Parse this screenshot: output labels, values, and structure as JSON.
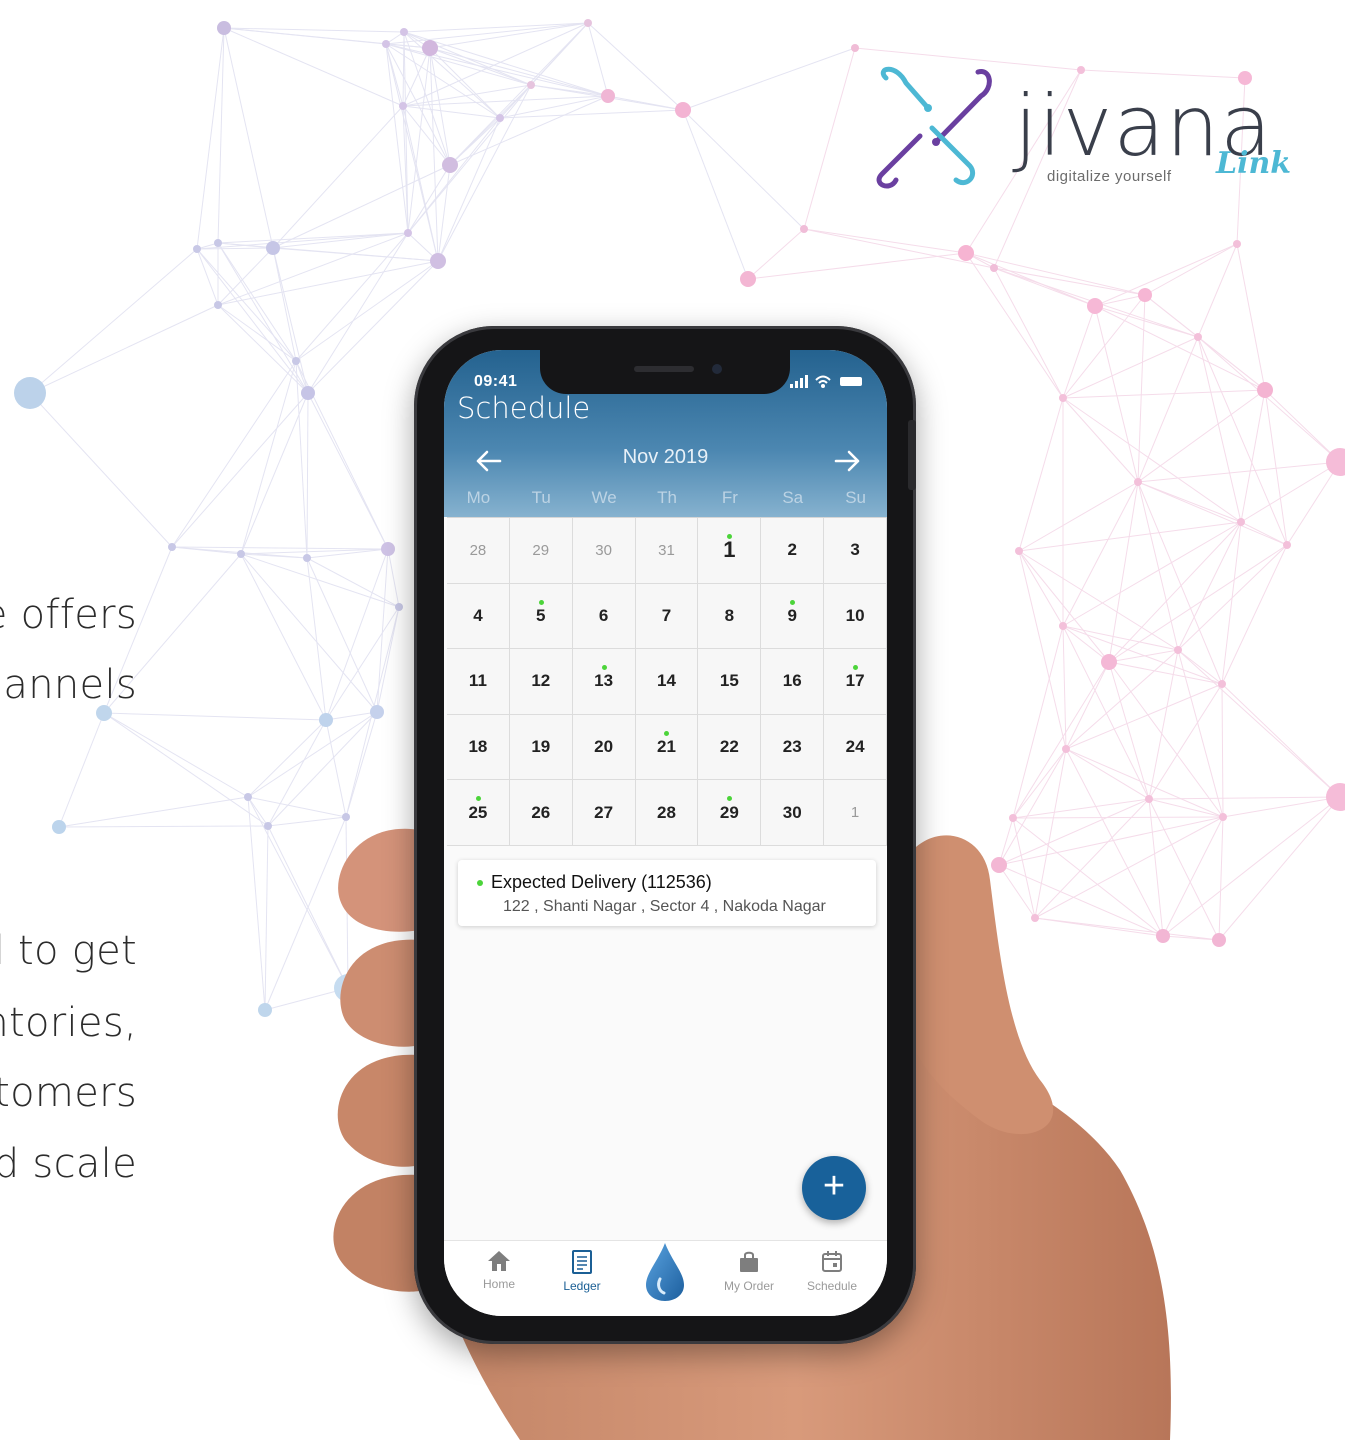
{
  "marketing": {
    "lines": [
      "e offers",
      "hannels",
      "d to get",
      "entories,",
      "stomers",
      "d scale"
    ]
  },
  "brand": {
    "name": "jivana",
    "tagline": "digitalize yourself",
    "suffix": "Link"
  },
  "status_bar": {
    "time": "09:41"
  },
  "app": {
    "title": "Schedule",
    "month": "Nov 2019",
    "weekdays": [
      "Mo",
      "Tu",
      "We",
      "Th",
      "Fr",
      "Sa",
      "Su"
    ],
    "days": [
      {
        "d": "28",
        "muted": true
      },
      {
        "d": "29",
        "muted": true
      },
      {
        "d": "30",
        "muted": true
      },
      {
        "d": "31",
        "muted": true
      },
      {
        "d": "1",
        "dot": true,
        "today": true
      },
      {
        "d": "2"
      },
      {
        "d": "3"
      },
      {
        "d": "4"
      },
      {
        "d": "5",
        "dot": true
      },
      {
        "d": "6"
      },
      {
        "d": "7"
      },
      {
        "d": "8"
      },
      {
        "d": "9",
        "dot": true
      },
      {
        "d": "10"
      },
      {
        "d": "11"
      },
      {
        "d": "12"
      },
      {
        "d": "13",
        "dot": true
      },
      {
        "d": "14"
      },
      {
        "d": "15"
      },
      {
        "d": "16"
      },
      {
        "d": "17",
        "dot": true
      },
      {
        "d": "18"
      },
      {
        "d": "19"
      },
      {
        "d": "20"
      },
      {
        "d": "21",
        "dot": true
      },
      {
        "d": "22"
      },
      {
        "d": "23"
      },
      {
        "d": "24"
      },
      {
        "d": "25",
        "dot": true
      },
      {
        "d": "26"
      },
      {
        "d": "27"
      },
      {
        "d": "28"
      },
      {
        "d": "29",
        "dot": true
      },
      {
        "d": "30"
      },
      {
        "d": "1",
        "muted": true
      }
    ],
    "event": {
      "title": "Expected Delivery (112536)",
      "address": "122 , Shanti Nagar , Sector 4 , Nakoda Nagar"
    },
    "fab_label": "+",
    "tabs": [
      {
        "label": "Home",
        "icon": "home-icon"
      },
      {
        "label": "Ledger",
        "icon": "ledger-icon",
        "active": true
      },
      {
        "label": "My Order",
        "icon": "shopping-bag-icon"
      },
      {
        "label": "Schedule",
        "icon": "calendar-icon"
      }
    ],
    "center_icon": "water-drop-icon"
  },
  "colors": {
    "header_top": "#24628f",
    "accent": "#18619a",
    "event_dot": "#4cd43a",
    "logo_teal": "#4db8d4",
    "logo_purple": "#6a3fa0"
  }
}
